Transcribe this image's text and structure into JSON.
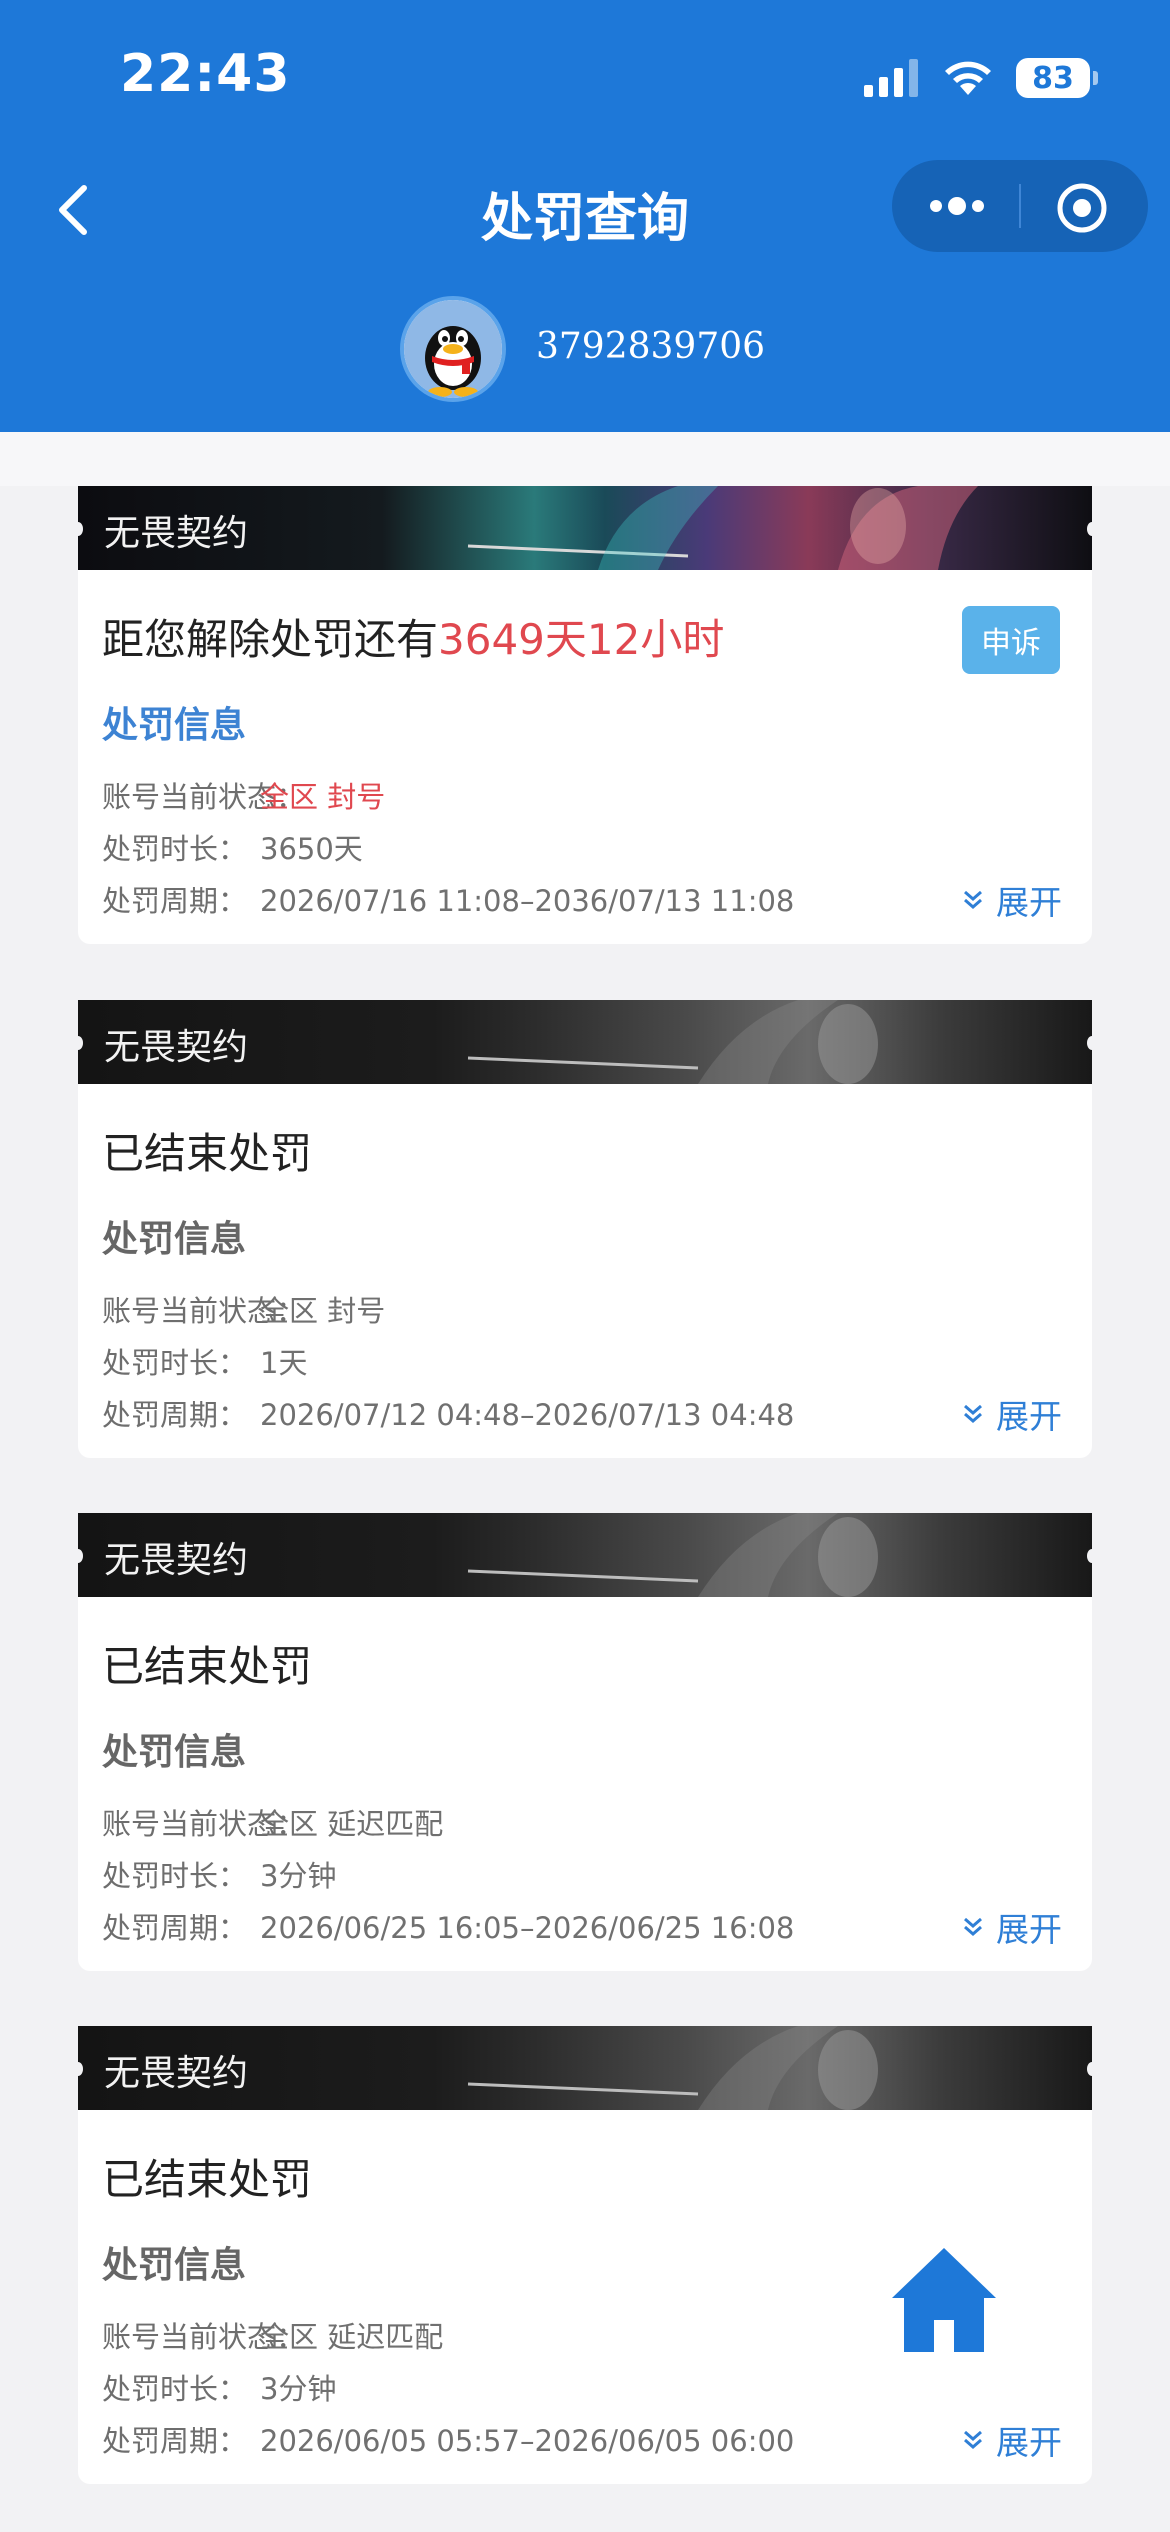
{
  "status_bar": {
    "time": "22:43",
    "battery": "83"
  },
  "nav": {
    "title": "处罚查询"
  },
  "user": {
    "id": "3792839706"
  },
  "cards": [
    {
      "game": "无畏契约",
      "title_prefix": "距您解除处罚还有",
      "title_highlight": "3649天12小时",
      "appeal_label": "申诉",
      "section_title": "处罚信息",
      "status_key": "账号当前状态：",
      "status_value": "全区 封号",
      "duration_key": "处罚时长：",
      "duration_value": "3650天",
      "period_key": "处罚周期：",
      "period_value": "2026/07/16 11:08–2036/07/13 11:08",
      "expand_label": "展开"
    },
    {
      "game": "无畏契约",
      "title": "已结束处罚",
      "section_title": "处罚信息",
      "status_key": "账号当前状态：",
      "status_value": "全区 封号",
      "duration_key": "处罚时长：",
      "duration_value": "1天",
      "period_key": "处罚周期：",
      "period_value": "2026/07/12 04:48–2026/07/13 04:48",
      "expand_label": "展开"
    },
    {
      "game": "无畏契约",
      "title": "已结束处罚",
      "section_title": "处罚信息",
      "status_key": "账号当前状态：",
      "status_value": "全区 延迟匹配",
      "duration_key": "处罚时长：",
      "duration_value": "3分钟",
      "period_key": "处罚周期：",
      "period_value": "2026/06/25 16:05–2026/06/25 16:08",
      "expand_label": "展开"
    },
    {
      "game": "无畏契约",
      "title": "已结束处罚",
      "section_title": "处罚信息",
      "status_key": "账号当前状态：",
      "status_value": "全区 延迟匹配",
      "duration_key": "处罚时长：",
      "duration_value": "3分钟",
      "period_key": "处罚周期：",
      "period_value": "2026/06/05 05:57–2026/06/05 06:00",
      "expand_label": "展开"
    }
  ],
  "colors": {
    "header": "#1e78d8",
    "highlight": "#e0484f",
    "link": "#2f7fd6",
    "home": "#1e78d8"
  }
}
